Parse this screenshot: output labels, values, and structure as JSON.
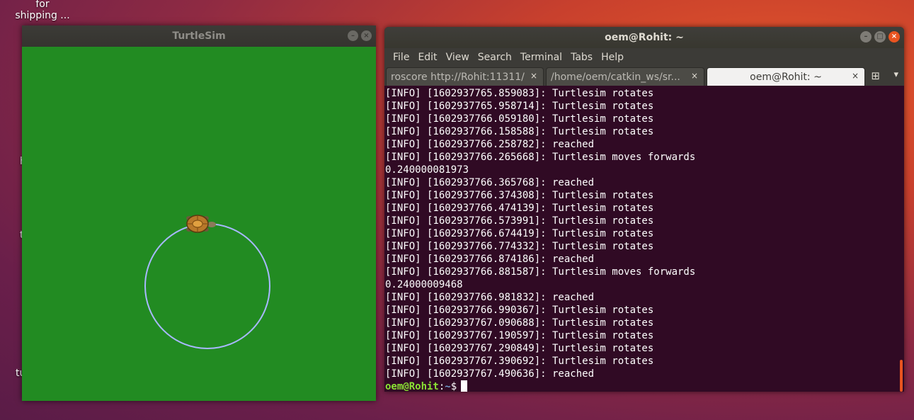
{
  "desktop": {
    "icon_label_line1": "for",
    "icon_label_line2": "shipping ...",
    "fragments": [
      "h",
      "t",
      "tu"
    ]
  },
  "turtlesim": {
    "title": "TurtleSim",
    "minimize_glyph": "–",
    "close_glyph": "×",
    "background_color": "#228b22",
    "path_color": "#a8b8ff"
  },
  "terminal": {
    "title": "oem@Rohit: ~",
    "menu": [
      "File",
      "Edit",
      "View",
      "Search",
      "Terminal",
      "Tabs",
      "Help"
    ],
    "tabs": [
      {
        "label": "roscore http://Rohit:11311/",
        "active": false
      },
      {
        "label": "/home/oem/catkin_ws/sr...",
        "active": false
      },
      {
        "label": "oem@Rohit: ~",
        "active": true
      }
    ],
    "tab_close_glyph": "×",
    "new_tab_glyph": "⊞",
    "tabs_menu_glyph": "▾",
    "lines": [
      "[INFO] [1602937765.859083]: Turtlesim rotates",
      "[INFO] [1602937765.958714]: Turtlesim rotates",
      "[INFO] [1602937766.059180]: Turtlesim rotates",
      "[INFO] [1602937766.158588]: Turtlesim rotates",
      "[INFO] [1602937766.258782]: reached",
      "[INFO] [1602937766.265668]: Turtlesim moves forwards",
      "0.240000081973",
      "[INFO] [1602937766.365768]: reached",
      "[INFO] [1602937766.374308]: Turtlesim rotates",
      "[INFO] [1602937766.474139]: Turtlesim rotates",
      "[INFO] [1602937766.573991]: Turtlesim rotates",
      "[INFO] [1602937766.674419]: Turtlesim rotates",
      "[INFO] [1602937766.774332]: Turtlesim rotates",
      "[INFO] [1602937766.874186]: reached",
      "[INFO] [1602937766.881587]: Turtlesim moves forwards",
      "0.24000009468",
      "[INFO] [1602937766.981832]: reached",
      "[INFO] [1602937766.990367]: Turtlesim rotates",
      "[INFO] [1602937767.090688]: Turtlesim rotates",
      "[INFO] [1602937767.190597]: Turtlesim rotates",
      "[INFO] [1602937767.290849]: Turtlesim rotates",
      "[INFO] [1602937767.390692]: Turtlesim rotates",
      "[INFO] [1602937767.490636]: reached"
    ],
    "prompt_user": "oem@Rohit",
    "prompt_sep": ":",
    "prompt_path": "~",
    "prompt_symbol": "$",
    "scroll_position": 0.92
  }
}
